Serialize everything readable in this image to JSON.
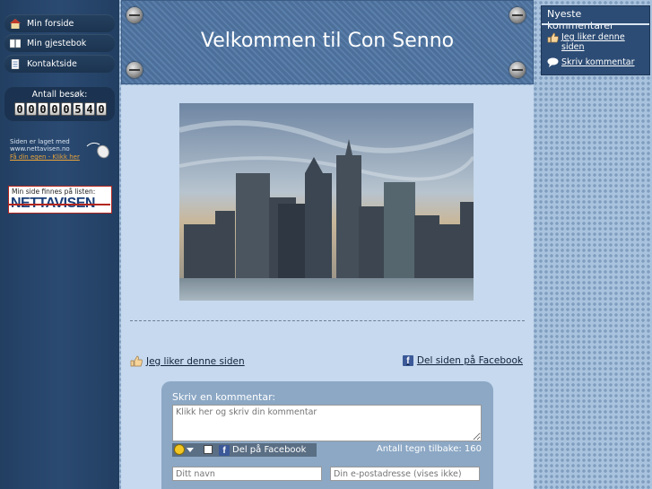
{
  "nav": {
    "items": [
      {
        "label": "Min forside",
        "icon": "home-icon"
      },
      {
        "label": "Min gjestebok",
        "icon": "book-icon"
      },
      {
        "label": "Kontaktside",
        "icon": "document-icon"
      }
    ]
  },
  "counter": {
    "label": "Antall besøk:",
    "digits": [
      "0",
      "0",
      "0",
      "0",
      "0",
      "5",
      "4",
      "0"
    ]
  },
  "madewith": {
    "line1": "Siden er laget med",
    "line2": "www.nettavisen.no",
    "link": "Få din egen - Klikk her"
  },
  "listing": {
    "text": "Min side finnes på listen:",
    "logo": "NETTAVISEN"
  },
  "header": {
    "title": "Velkommen til Con Senno"
  },
  "social": {
    "like": "Jeg liker denne siden",
    "share": "Del siden på Facebook"
  },
  "comment": {
    "heading": "Skriv en kommentar:",
    "placeholder": "Klikk her og skriv din kommentar",
    "fb_share": "Del på Facebook",
    "chars_left": "Antall tegn tilbake: 160",
    "name_placeholder": "Ditt navn",
    "email_placeholder": "Din e-postadresse (vises ikke)"
  },
  "sidebar": {
    "heading": "Nyeste kommentarer",
    "items": [
      {
        "label": "Jeg liker denne siden"
      },
      {
        "label": "Skriv kommentar"
      }
    ]
  },
  "colors": {
    "left_bg": "#2b4a72",
    "main_bg": "#c6d9ee",
    "accent": "#e9a33a",
    "fb": "#3b5998"
  }
}
